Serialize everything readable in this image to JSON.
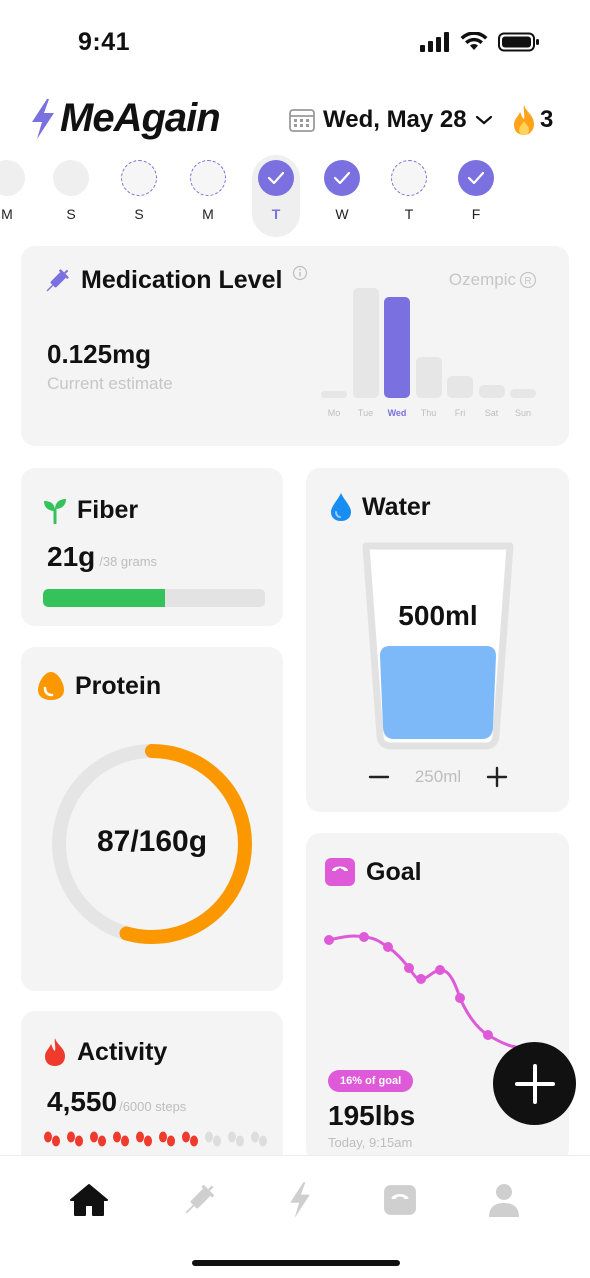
{
  "status_bar": {
    "time": "9:41"
  },
  "header": {
    "app_name": "MeAgain",
    "date_label": "Wed, May 28",
    "streak_count": "3"
  },
  "week": [
    {
      "label": "M",
      "state": "gray"
    },
    {
      "label": "S",
      "state": "gray"
    },
    {
      "label": "S",
      "state": "dashed"
    },
    {
      "label": "M",
      "state": "dashed"
    },
    {
      "label": "T",
      "state": "checked",
      "selected": true
    },
    {
      "label": "W",
      "state": "checked"
    },
    {
      "label": "T",
      "state": "dashed"
    },
    {
      "label": "F",
      "state": "checked"
    }
  ],
  "medication": {
    "title": "Medication Level",
    "brand": "Ozempic",
    "value": "0.125mg",
    "subtitle": "Current estimate",
    "days": [
      "Mo",
      "Tue",
      "Wed",
      "Thu",
      "Fri",
      "Sat",
      "Sun"
    ],
    "levels": [
      0.06,
      1.0,
      0.92,
      0.37,
      0.2,
      0.12,
      0.08
    ],
    "highlight_day": "Wed",
    "accent_color": "#7b70e0"
  },
  "fiber": {
    "title": "Fiber",
    "value": "21g",
    "max": "/38 grams",
    "progress": 0.55,
    "color": "#35c25a"
  },
  "water": {
    "title": "Water",
    "value": "500ml",
    "step": "250ml",
    "minus": "−",
    "plus": "+",
    "fill_fraction": 0.5,
    "color": "#7db9f9"
  },
  "protein": {
    "title": "Protein",
    "value": "87/160g",
    "progress": 0.544,
    "color": "#fb9800"
  },
  "goal": {
    "title": "Goal",
    "badge": "16% of goal",
    "weight": "195lbs",
    "timestamp": "Today, 9:15am",
    "color": "#de5ad8"
  },
  "activity": {
    "title": "Activity",
    "value": "4,550",
    "max": "/6000 steps",
    "steps_filled": 7,
    "steps_total": 10,
    "color": "#ef3b2d"
  },
  "tab_bar": {
    "items": [
      "home-icon",
      "syringe-icon",
      "bolt-icon",
      "scale-icon",
      "profile-icon"
    ],
    "active": "home-icon"
  }
}
